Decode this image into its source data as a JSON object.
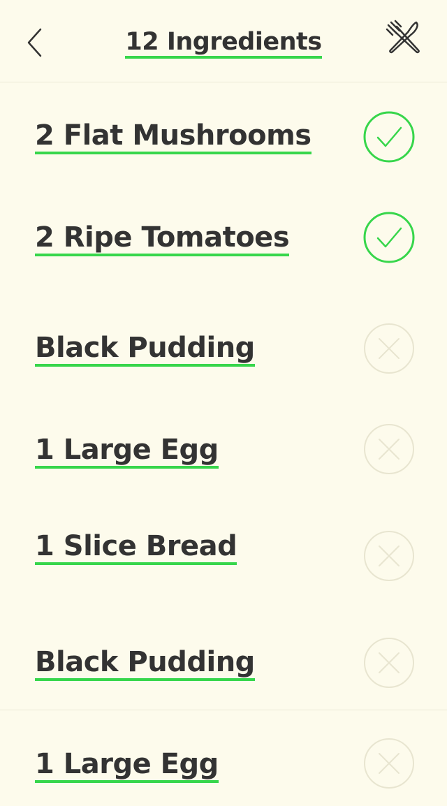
{
  "header": {
    "title": "12 Ingredients",
    "back_icon": "chevron-left-icon",
    "utensils_icon": "fork-knife-icon"
  },
  "colors": {
    "background": "#fdfbec",
    "text": "#333333",
    "accent": "#37d64b",
    "inactive": "#e8e5d0"
  },
  "ingredients": [
    {
      "label": "2 Flat Mushrooms",
      "checked": true
    },
    {
      "label": "2 Ripe Tomatoes",
      "checked": true
    },
    {
      "label": "Black Pudding",
      "checked": false
    },
    {
      "label": "1 Large Egg",
      "checked": false
    },
    {
      "label": "1 Slice Bread",
      "checked": false
    },
    {
      "label": "Black Pudding",
      "checked": false
    },
    {
      "label": "1 Large Egg",
      "checked": false
    }
  ]
}
